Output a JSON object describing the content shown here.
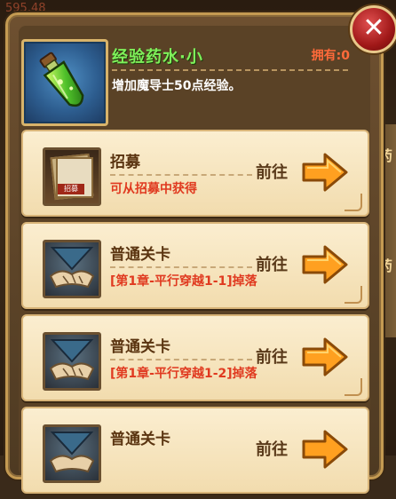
{
  "background": {
    "top_text": "595.48",
    "side_chars": [
      "药",
      "药"
    ]
  },
  "item": {
    "name": "经验药水·小",
    "owned": "拥有:0",
    "description": "增加魔导士50点经验。",
    "icon": "green-potion-icon"
  },
  "close_label": "✕",
  "sources": [
    {
      "name": "招募",
      "detail": "可从招募中获得",
      "goto": "前往",
      "icon": "recruit-card-icon"
    },
    {
      "name": "普通关卡",
      "detail": "[第1章-平行穿越1-1]掉落",
      "goto": "前往",
      "icon": "handshake-stage-icon"
    },
    {
      "name": "普通关卡",
      "detail": "[第1章-平行穿越1-2]掉落",
      "goto": "前往",
      "icon": "handshake-stage-icon"
    },
    {
      "name": "普通关卡",
      "detail": "",
      "goto": "前往",
      "icon": "handshake-stage-icon"
    }
  ],
  "recruit_icon_text": "招募",
  "colors": {
    "title_green": "#7ff05a",
    "owned_red": "#ff6a3a",
    "detail_red": "#e03a20",
    "arrow_orange": "#ffa020"
  }
}
